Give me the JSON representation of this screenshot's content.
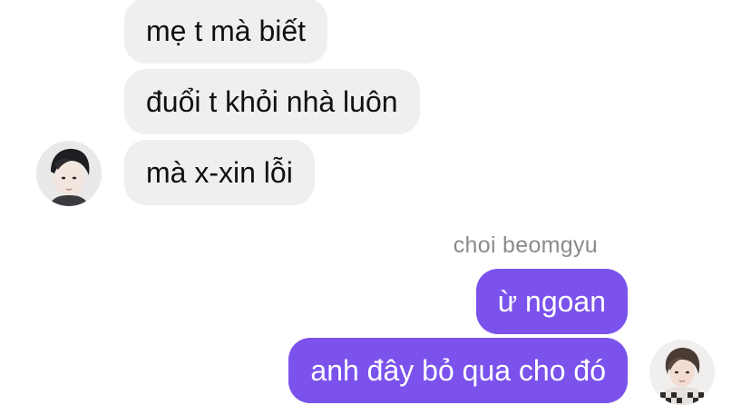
{
  "conversation": {
    "incoming_messages": [
      "mẹ t mà biết",
      "đuổi t khỏi nhà luôn",
      "mà x-xin lỗi"
    ],
    "outgoing_sender_name": "choi beomgyu",
    "outgoing_messages": [
      "ừ ngoan",
      "anh đây bỏ qua cho đó"
    ]
  },
  "colors": {
    "incoming_bubble": "#efeff1",
    "outgoing_bubble": "#7b52ec",
    "sender_name": "#8b8b8f"
  },
  "icons": {
    "left_avatar": "profile-photo",
    "right_avatar": "profile-photo"
  }
}
